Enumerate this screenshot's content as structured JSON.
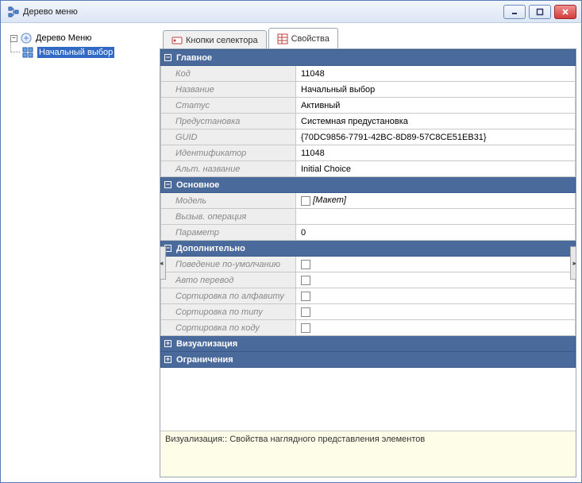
{
  "window": {
    "title": "Дерево меню"
  },
  "tree": {
    "root_label": "Дерево Меню",
    "child_label": "Начальный выбор"
  },
  "tabs": {
    "selector_buttons": "Кнопки селектора",
    "properties": "Свойства"
  },
  "groups": {
    "main": {
      "title": "Главное",
      "code_label": "Код",
      "code_value": "11048",
      "name_label": "Название",
      "name_value": "Начальный выбор",
      "status_label": "Статус",
      "status_value": "Активный",
      "preset_label": "Предустановка",
      "preset_value": "Системная предустановка",
      "guid_label": "GUID",
      "guid_value": "{70DC9856-7791-42BC-8D89-57C8CE51EB31}",
      "id_label": "Идентификатор",
      "id_value": "11048",
      "alt_name_label": "Альт. название",
      "alt_name_value": "Initial Choice"
    },
    "basic": {
      "title": "Основное",
      "model_label": "Модель",
      "model_value": "[Макет]",
      "op_label": "Вызыв. операция",
      "op_value": "",
      "param_label": "Параметр",
      "param_value": "0"
    },
    "extra": {
      "title": "Дополнительно",
      "default_behavior_label": "Поведение по-умолчанию",
      "auto_translate_label": "Авто перевод",
      "sort_alpha_label": "Сортировка по алфавиту",
      "sort_type_label": "Сортировка по типу",
      "sort_code_label": "Сортировка по коду"
    },
    "visual": {
      "title": "Визуализация"
    },
    "restrict": {
      "title": "Ограничения"
    }
  },
  "hint": "Визуализация:: Свойства наглядного представления элементов"
}
